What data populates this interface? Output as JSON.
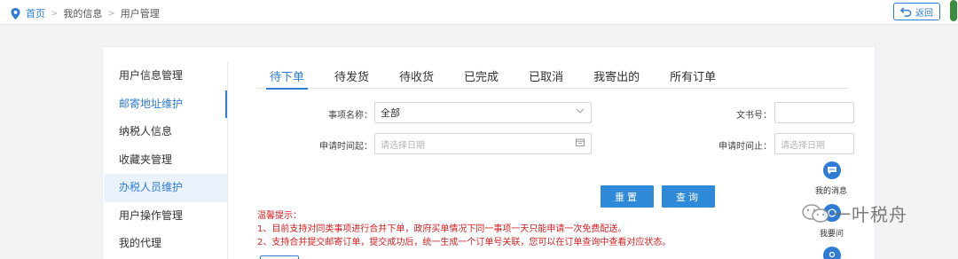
{
  "breadcrumb": {
    "home": "首页",
    "items": [
      "我的信息",
      "用户管理"
    ],
    "separator": ">"
  },
  "back_button": {
    "label": "返回",
    "icon": "return-arrow-icon"
  },
  "sidebar": {
    "items": [
      {
        "label": "用户信息管理"
      },
      {
        "label": "邮寄地址维护",
        "state": "active"
      },
      {
        "label": "纳税人信息"
      },
      {
        "label": "收藏夹管理"
      },
      {
        "label": "办税人员维护",
        "state": "highlighted"
      },
      {
        "label": "用户操作管理"
      },
      {
        "label": "我的代理"
      }
    ]
  },
  "tabs": [
    {
      "label": "待下单",
      "active": true
    },
    {
      "label": "待发货"
    },
    {
      "label": "待收货"
    },
    {
      "label": "已完成"
    },
    {
      "label": "已取消"
    },
    {
      "label": "我寄出的"
    },
    {
      "label": "所有订单"
    }
  ],
  "form": {
    "item_name": {
      "label": "事项名称：",
      "value": "全部"
    },
    "doc_no": {
      "label": "文书号：",
      "value": ""
    },
    "apply_start": {
      "label": "申请时间起：",
      "placeholder": "请选择日期"
    },
    "apply_end": {
      "label": "申请时间止：",
      "placeholder": "请选择日期"
    }
  },
  "buttons": {
    "reset": "重置",
    "query": "查询"
  },
  "tips": {
    "title": "温馨提示：",
    "lines": [
      "1、目前支持对同类事项进行合并下单，政府买单情况下同一事项一天只能申请一次免费配送。",
      "2、支持合并提交邮寄订单，提交成功后，统一生成一个订单号关联，您可以在订单查询中查看对应状态。"
    ]
  },
  "floating": {
    "message": {
      "label": "我的消息",
      "icon": "chat-bubble-icon"
    },
    "ask": {
      "label": "我要问",
      "icon": "question-icon"
    },
    "third": {
      "icon": "location-icon"
    }
  },
  "watermark": {
    "text": "一叶税舟",
    "icon": "wechat-logo-icon"
  },
  "colors": {
    "accent": "#2e7cd6",
    "tip": "#d42020",
    "button": "#2e8ad8"
  }
}
